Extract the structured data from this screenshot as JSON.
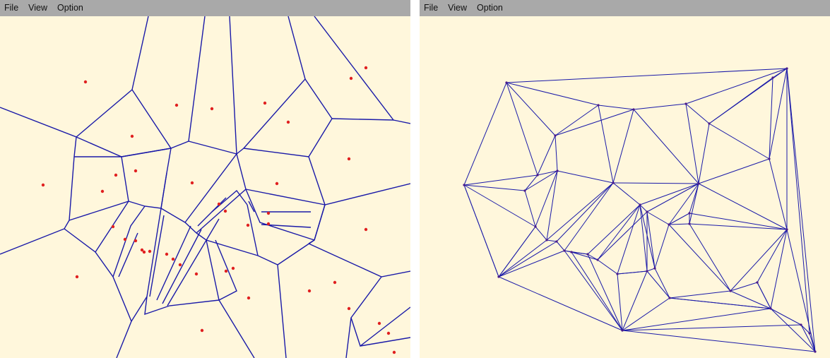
{
  "windows": [
    {
      "id": "voronoi",
      "menu": [
        "File",
        "View",
        "Option"
      ]
    },
    {
      "id": "delaunay",
      "menu": [
        "File",
        "View",
        "Option"
      ]
    }
  ],
  "colors": {
    "background": "#fff7dc",
    "menubar": "#a9a9a9",
    "edge": "#1a1aa8",
    "site": "#e02020",
    "vertex": "#4a1a8a"
  }
}
